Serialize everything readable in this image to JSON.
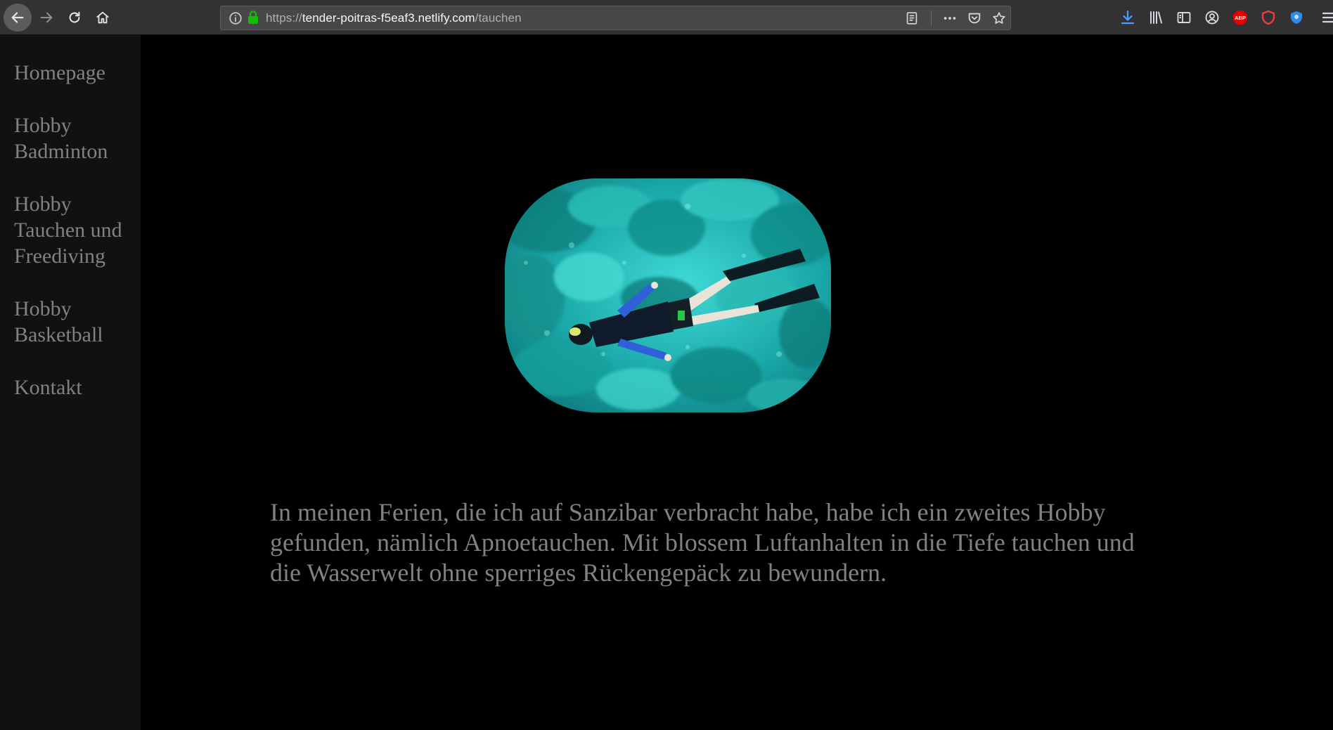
{
  "browser": {
    "url_prefix": "https://",
    "url_domain": "tender-poitras-f5eaf3.netlify.com",
    "url_path": "/tauchen",
    "extensions": [
      "ABP"
    ]
  },
  "sidebar": {
    "items": [
      {
        "label": "Homepage"
      },
      {
        "label": "Hobby Badminton"
      },
      {
        "label": "Hobby Tauchen und Freediving"
      },
      {
        "label": "Hobby Basketball"
      },
      {
        "label": "Kontakt"
      }
    ]
  },
  "main": {
    "paragraph": "In meinen Ferien, die ich auf Sanzibar verbracht habe, habe ich ein zweites Hobby gefunden, nämlich Apnoetauchen. Mit blossem Luftanhalten in die Tiefe tauchen und die Wasserwelt ohne sperriges Rückengepäck zu bewundern."
  },
  "colors": {
    "page_background": "#000000",
    "sidebar_background": "#111111",
    "text": "#818181",
    "water": "#1fb5b5"
  }
}
